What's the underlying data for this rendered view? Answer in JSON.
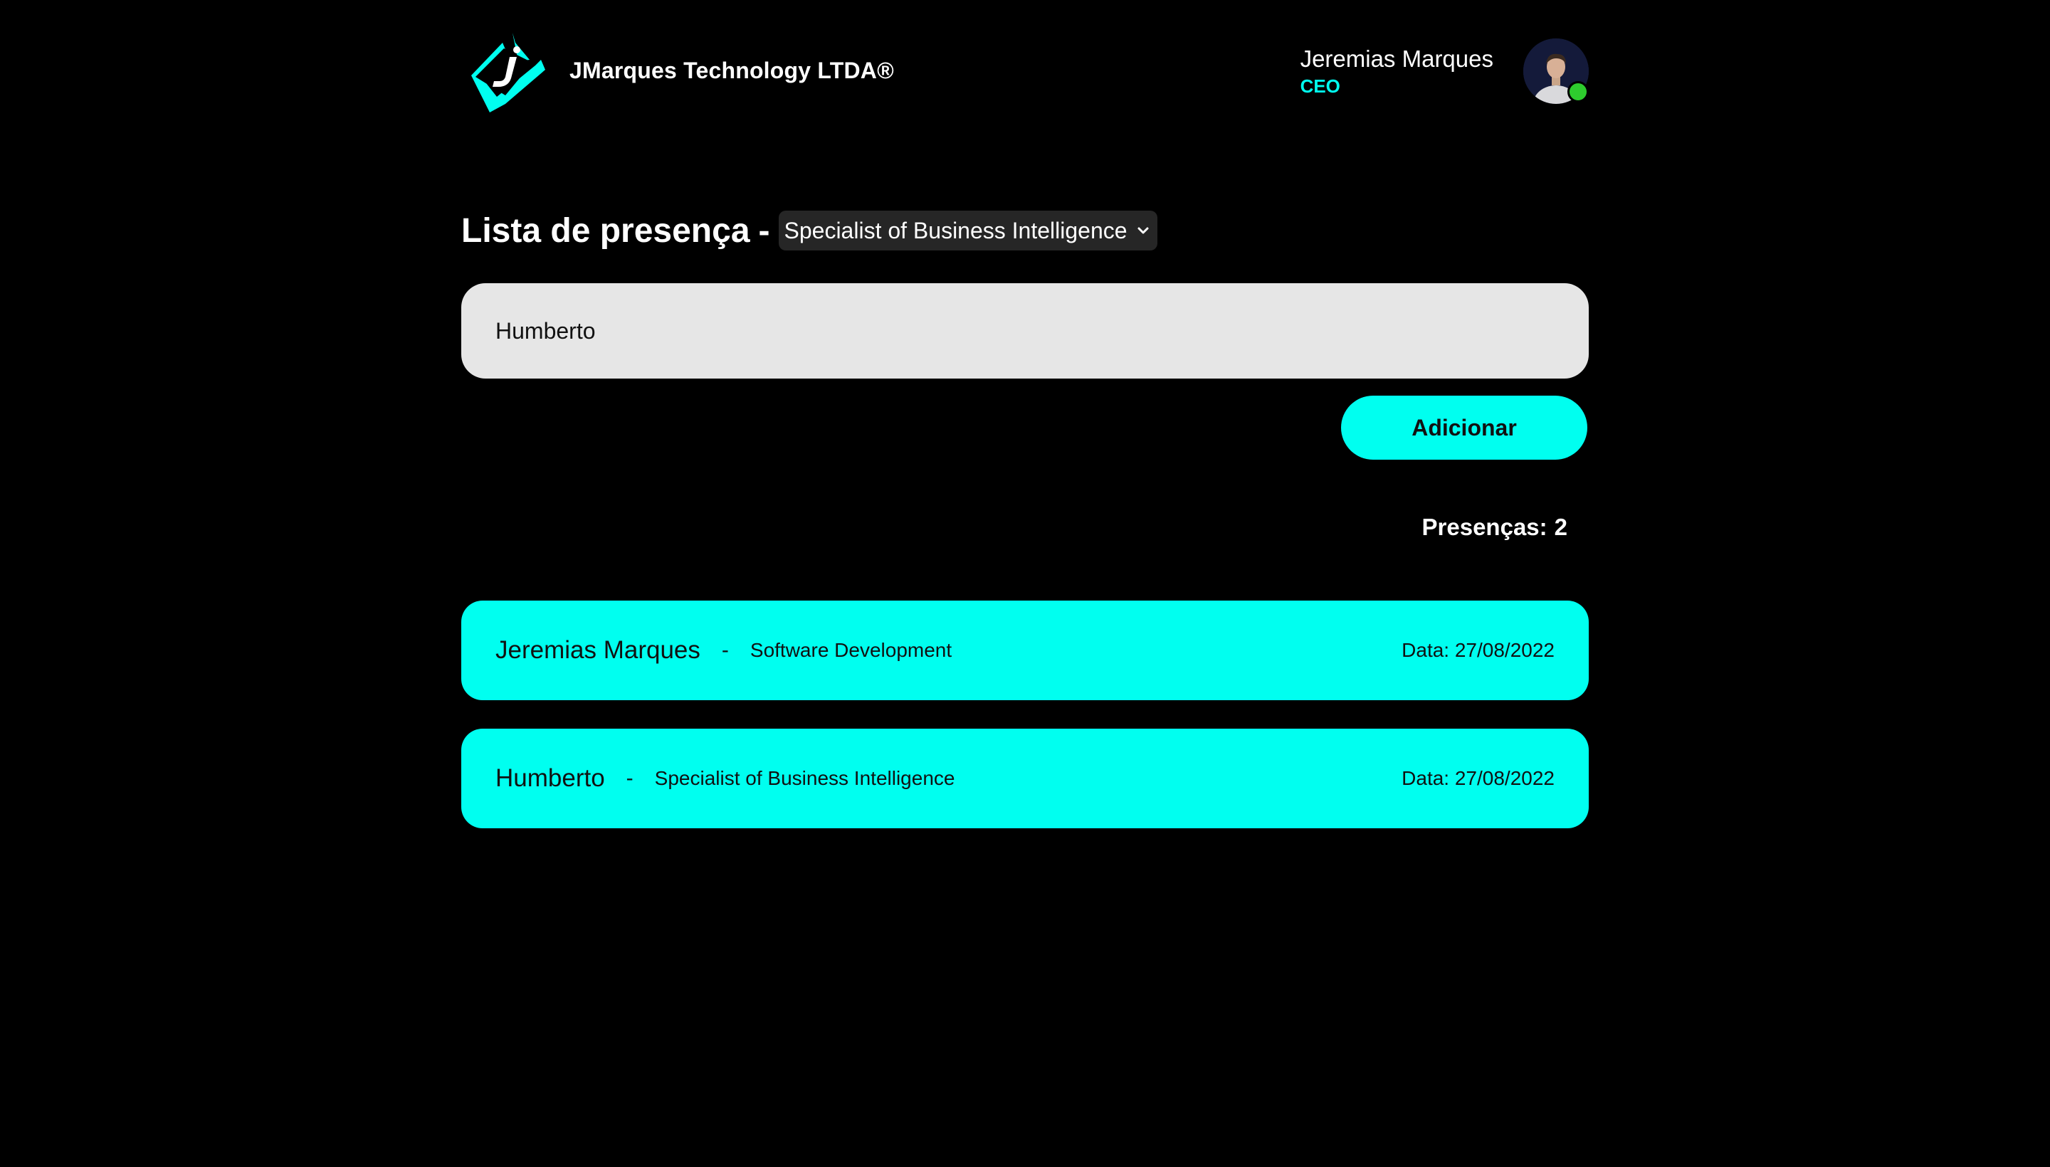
{
  "header": {
    "company_name": "JMarques Technology LTDA®",
    "user": {
      "name": "Jeremias Marques",
      "role": "CEO",
      "status": "online"
    }
  },
  "main": {
    "title": "Lista de presença",
    "title_separator": "-",
    "role_select": {
      "selected": "Specialist of Business Intelligence"
    },
    "name_input": {
      "value": "Humberto"
    },
    "add_button_label": "Adicionar",
    "attendance_count": {
      "label": "Presenças:",
      "value": "2"
    },
    "attendees": [
      {
        "name": "Jeremias Marques",
        "separator": "-",
        "role": "Software Development",
        "date": "Data: 27/08/2022"
      },
      {
        "name": "Humberto",
        "separator": "-",
        "role": "Specialist of Business Intelligence",
        "date": "Data: 27/08/2022"
      }
    ]
  },
  "colors": {
    "accent": "#00fff0",
    "background": "#000000",
    "input_bg": "#e6e6e6",
    "online": "#2ecc2e"
  },
  "icons": {
    "logo": "jmarques-logo-icon",
    "select": "chevron-down-icon",
    "avatar": "avatar"
  }
}
